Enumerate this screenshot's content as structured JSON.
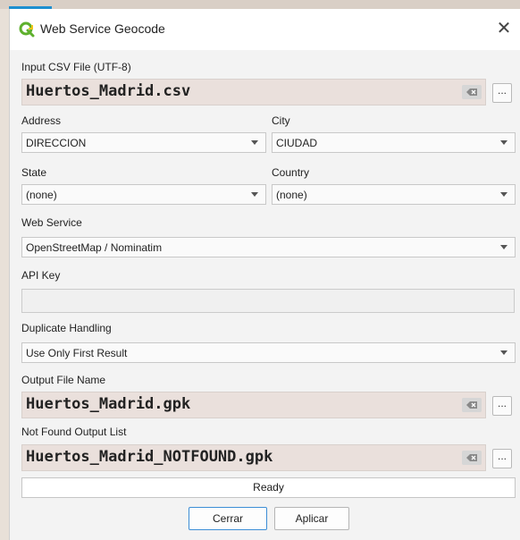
{
  "window": {
    "title": "Web Service Geocode",
    "close_glyph": "✕"
  },
  "input_csv": {
    "label": "Input CSV File (UTF-8)",
    "value": "Huertos_Madrid.csv",
    "browse_label": "..."
  },
  "address": {
    "label": "Address",
    "value": "DIRECCION"
  },
  "city": {
    "label": "City",
    "value": "CIUDAD"
  },
  "state": {
    "label": "State",
    "value": "(none)"
  },
  "country": {
    "label": "Country",
    "value": "(none)"
  },
  "web_service": {
    "label": "Web Service",
    "value": "OpenStreetMap / Nominatim"
  },
  "api_key": {
    "label": "API Key",
    "value": ""
  },
  "duplicate_handling": {
    "label": "Duplicate Handling",
    "value": "Use Only First Result"
  },
  "output_file": {
    "label": "Output File Name",
    "value": "Huertos_Madrid.gpk",
    "browse_label": "..."
  },
  "not_found": {
    "label": "Not Found Output List",
    "value": "Huertos_Madrid_NOTFOUND.gpk",
    "browse_label": "..."
  },
  "status": {
    "text": "Ready"
  },
  "buttons": {
    "close_label": "Cerrar",
    "apply_label": "Aplicar"
  },
  "colors": {
    "qgis_green": "#5eb02d",
    "accent": "#3d8ed6",
    "file_field": "#eae0dc"
  }
}
